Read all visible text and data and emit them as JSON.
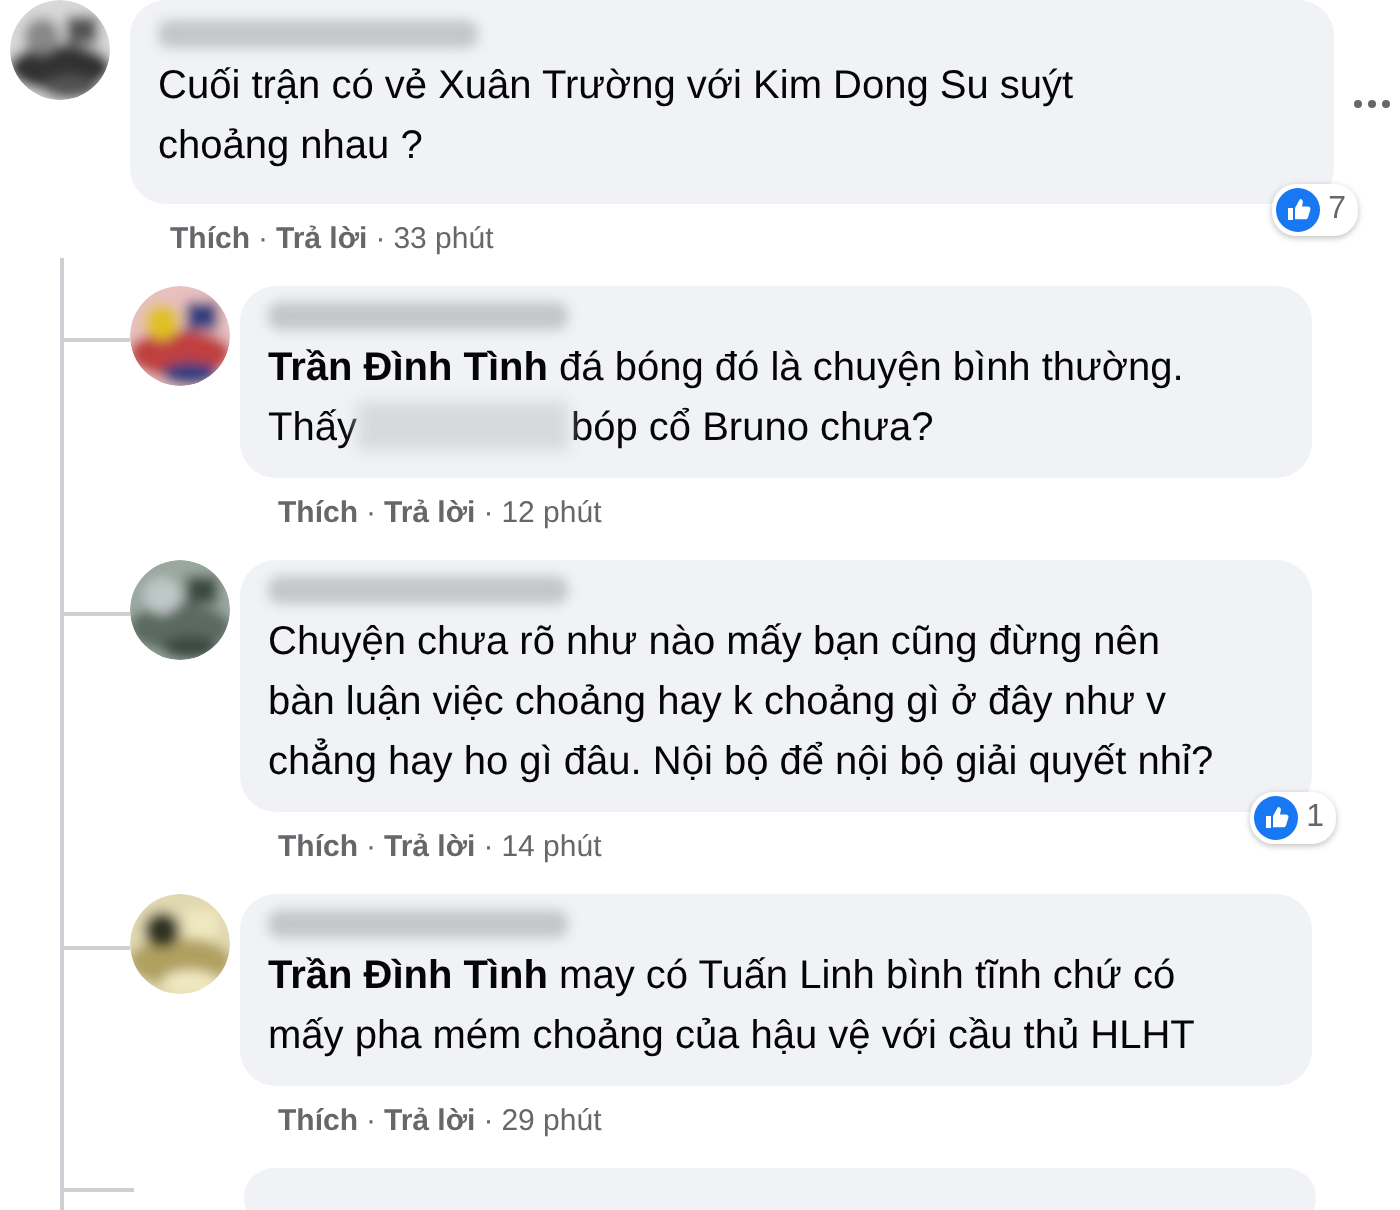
{
  "comment": {
    "segments": [
      "Cuối trận có vẻ Xuân Trường với Kim Dong Su suýt choảng nhau ?"
    ],
    "reactions": {
      "count": "7"
    },
    "actions": {
      "like": "Thích",
      "sep1": "·",
      "reply": "Trả lời",
      "sep2": "·",
      "time": "33 phút"
    }
  },
  "replies": [
    {
      "segments": [
        "**Trần Đình Tình** đá bóng đó là chuyện bình thường. Thấy",
        "bóp cổ Bruno chưa?"
      ],
      "actions": {
        "like": "Thích",
        "sep1": "·",
        "reply": "Trả lời",
        "sep2": "·",
        "time": "12 phút"
      }
    },
    {
      "segments": [
        "Chuyện chưa rõ như nào mấy bạn cũng đừng nên bàn luận việc choảng hay k choảng gì ở đây như v chẳng hay ho gì đâu. Nội bộ để nội bộ giải quyết nhỉ?"
      ],
      "reactions": {
        "count": "1"
      },
      "actions": {
        "like": "Thích",
        "sep1": "·",
        "reply": "Trả lời",
        "sep2": "·",
        "time": "14 phút"
      }
    },
    {
      "segments": [
        "**Trần Đình Tình** may có Tuấn Linh bình tĩnh chứ có mấy pha mém choảng của hậu vệ với cầu thủ HLHT"
      ],
      "actions": {
        "like": "Thích",
        "sep1": "·",
        "reply": "Trả lời",
        "sep2": "·",
        "time": "29 phút"
      }
    }
  ]
}
